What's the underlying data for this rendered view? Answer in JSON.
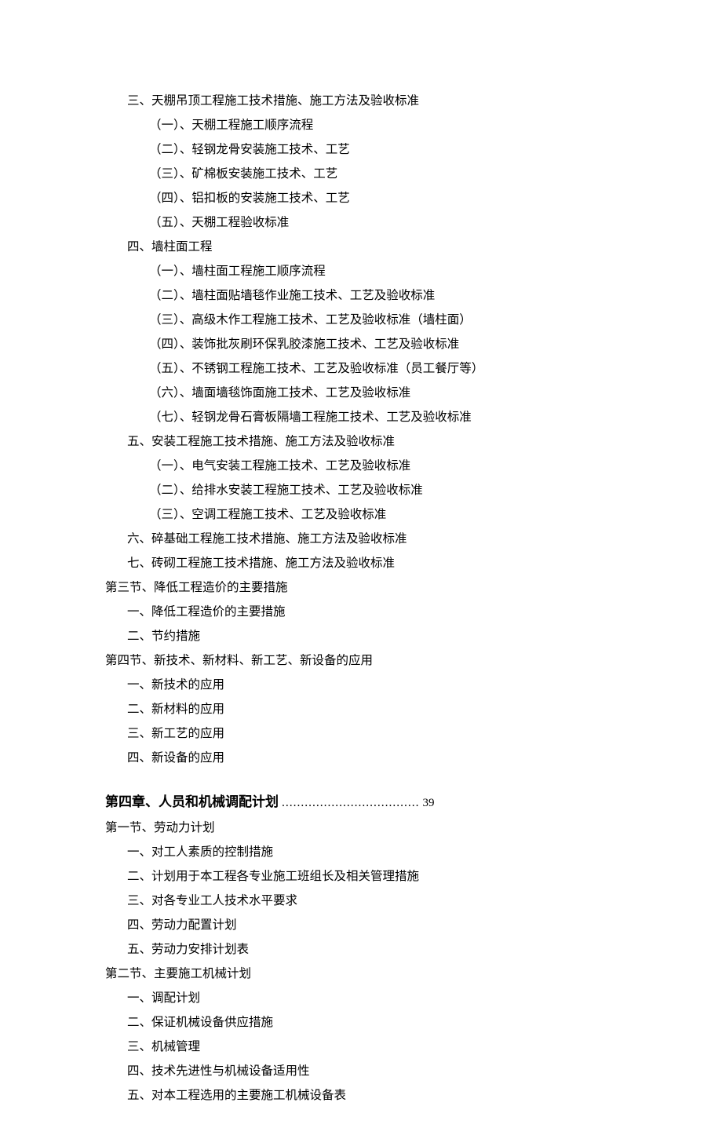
{
  "block_a": [
    {
      "cls": "lvl1",
      "text": "三、天棚吊顶工程施工技术措施、施工方法及验收标准"
    },
    {
      "cls": "lvl2",
      "text": "（一）、天棚工程施工顺序流程"
    },
    {
      "cls": "lvl2",
      "text": "（二）、轻钢龙骨安装施工技术、工艺"
    },
    {
      "cls": "lvl2",
      "text": "（三）、矿棉板安装施工技术、工艺"
    },
    {
      "cls": "lvl2",
      "text": "（四）、铝扣板的安装施工技术、工艺"
    },
    {
      "cls": "lvl2",
      "text": "（五）、天棚工程验收标准"
    },
    {
      "cls": "lvl1",
      "text": "四、墙柱面工程"
    },
    {
      "cls": "lvl2",
      "text": "（一）、墙柱面工程施工顺序流程"
    },
    {
      "cls": "lvl2",
      "text": "（二）、墙柱面贴墙毯作业施工技术、工艺及验收标准"
    },
    {
      "cls": "lvl2",
      "text": "（三）、高级木作工程施工技术、工艺及验收标准（墙柱面）"
    },
    {
      "cls": "lvl2",
      "text": "（四）、装饰批灰刷环保乳胶漆施工技术、工艺及验收标准"
    },
    {
      "cls": "lvl2",
      "text": "（五）、不锈钢工程施工技术、工艺及验收标准（员工餐厅等）"
    },
    {
      "cls": "lvl2",
      "text": "（六）、墙面墙毯饰面施工技术、工艺及验收标准"
    },
    {
      "cls": "lvl2",
      "text": "（七）、轻钢龙骨石膏板隔墙工程施工技术、工艺及验收标准"
    },
    {
      "cls": "lvl1",
      "text": "五、安装工程施工技术措施、施工方法及验收标准"
    },
    {
      "cls": "lvl2",
      "text": "（一）、电气安装工程施工技术、工艺及验收标准"
    },
    {
      "cls": "lvl2",
      "text": "（二）、给排水安装工程施工技术、工艺及验收标准"
    },
    {
      "cls": "lvl2",
      "text": "（三）、空调工程施工技术、工艺及验收标准"
    },
    {
      "cls": "lvl1",
      "text": "六、碎基础工程施工技术措施、施工方法及验收标准"
    },
    {
      "cls": "lvl1",
      "text": "七、砖砌工程施工技术措施、施工方法及验收标准"
    },
    {
      "cls": "lvl3",
      "text": "第三节、降低工程造价的主要措施"
    },
    {
      "cls": "lvl1",
      "text": "一、降低工程造价的主要措施"
    },
    {
      "cls": "lvl1",
      "text": "二、节约措施"
    },
    {
      "cls": "lvl3",
      "text": "第四节、新技术、新材料、新工艺、新设备的应用"
    },
    {
      "cls": "lvl1",
      "text": "一、新技术的应用"
    },
    {
      "cls": "lvl1",
      "text": "二、新材料的应用"
    },
    {
      "cls": "lvl1",
      "text": "三、新工艺的应用"
    },
    {
      "cls": "lvl1",
      "text": "四、新设备的应用"
    }
  ],
  "chapter4": {
    "title": "第四章、人员和机械调配计划",
    "dots": "....................................",
    "page": "39"
  },
  "block_b": [
    {
      "cls": "lvl3",
      "text": "第一节、劳动力计划"
    },
    {
      "cls": "lvl1",
      "text": "一、对工人素质的控制措施"
    },
    {
      "cls": "lvl1",
      "text": "二、计划用于本工程各专业施工班组长及相关管理措施"
    },
    {
      "cls": "lvl1",
      "text": "三、对各专业工人技术水平要求"
    },
    {
      "cls": "lvl1",
      "text": "四、劳动力配置计划"
    },
    {
      "cls": "lvl1",
      "text": "五、劳动力安排计划表"
    },
    {
      "cls": "lvl3",
      "text": "第二节、主要施工机械计划"
    },
    {
      "cls": "lvl1",
      "text": "一、调配计划"
    },
    {
      "cls": "lvl1",
      "text": "二、保证机械设备供应措施"
    },
    {
      "cls": "lvl1",
      "text": "三、机械管理"
    },
    {
      "cls": "lvl1",
      "text": "四、技术先进性与机械设备适用性"
    },
    {
      "cls": "lvl1",
      "text": "五、对本工程选用的主要施工机械设备表"
    }
  ]
}
